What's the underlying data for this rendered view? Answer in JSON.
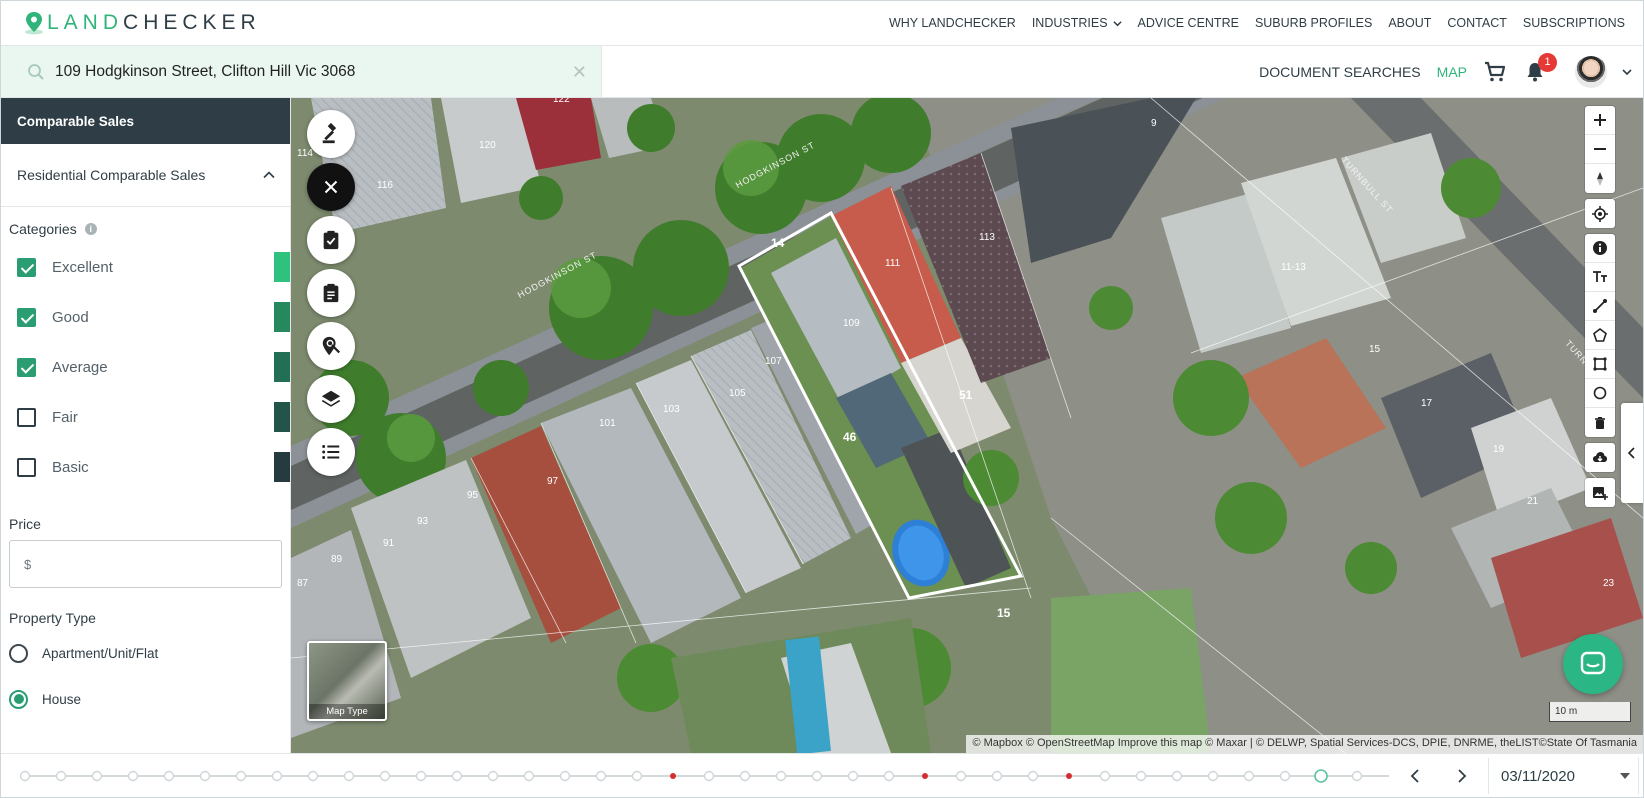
{
  "brand": {
    "name_part1": "LAND",
    "name_part2": "CHECKER",
    "accent": "#31b47a",
    "dark": "#2f3e46"
  },
  "nav": {
    "links": [
      "WHY LANDCHECKER",
      "INDUSTRIES",
      "ADVICE CENTRE",
      "SUBURB PROFILES",
      "ABOUT",
      "CONTACT",
      "SUBSCRIPTIONS"
    ]
  },
  "search": {
    "value": "109 Hodgkinson Street, Clifton Hill Vic 3068",
    "clear_icon": "close-icon"
  },
  "actions": {
    "document_searches": "DOCUMENT SEARCHES",
    "map": "MAP",
    "notification_count": "1"
  },
  "panel": {
    "header": "Comparable Sales",
    "section": "Residential Comparable Sales",
    "categories_title": "Categories",
    "categories": [
      {
        "label": "Excellent",
        "checked": true,
        "color": "#2fc27f"
      },
      {
        "label": "Good",
        "checked": true,
        "color": "#26885d"
      },
      {
        "label": "Average",
        "checked": true,
        "color": "#236f55"
      },
      {
        "label": "Fair",
        "checked": false,
        "color": "#22544a"
      },
      {
        "label": "Basic",
        "checked": false,
        "color": "#263b40"
      }
    ],
    "price_title": "Price",
    "price_placeholder": "$",
    "property_type_title": "Property Type",
    "property_types": [
      {
        "label": "Apartment/Unit/Flat",
        "selected": false
      },
      {
        "label": "House",
        "selected": true
      }
    ]
  },
  "map": {
    "street_labels": [
      "HODGKINSON ST",
      "HODGKINSON ST",
      "TURNBULL ST",
      "TURNB"
    ],
    "lot_numbers": [
      "120",
      "122",
      "116",
      "114",
      "111",
      "113",
      "109",
      "107",
      "105",
      "103",
      "101",
      "97",
      "95",
      "93",
      "91",
      "89",
      "87",
      "11-13",
      "15",
      "17",
      "19",
      "21",
      "23",
      "9"
    ],
    "dimensions": [
      "14",
      "46",
      "51",
      "15"
    ],
    "map_type_label": "Map Type",
    "scale_label": "10 m",
    "attribution": "© Mapbox © OpenStreetMap Improve this map © Maxar | © DELWP, Spatial Services-DCS, DPIE, DNRME, theLIST©State Of Tasmania"
  },
  "timeline": {
    "date": "03/11/2020"
  }
}
